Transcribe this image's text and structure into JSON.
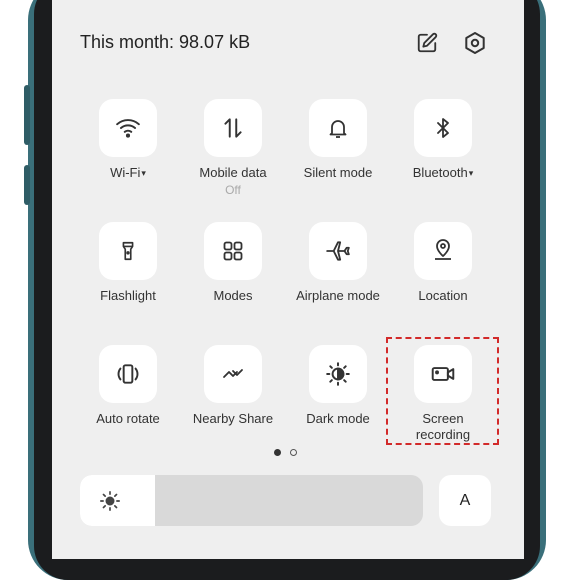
{
  "header": {
    "usage_text": "This month: 98.07 kB",
    "edit_icon": "edit-icon",
    "settings_icon": "settings-icon"
  },
  "tiles": [
    {
      "label": "Wi-Fi",
      "caret": "▾",
      "icon": "wifi-icon"
    },
    {
      "label": "Mobile data",
      "sub": "Off",
      "icon": "mobile-data-icon"
    },
    {
      "label": "Silent mode",
      "icon": "bell-icon"
    },
    {
      "label": "Bluetooth",
      "caret": "▾",
      "icon": "bluetooth-icon"
    },
    {
      "label": "Flashlight",
      "icon": "flashlight-icon"
    },
    {
      "label": "Modes",
      "icon": "modes-icon"
    },
    {
      "label": "Airplane mode",
      "icon": "airplane-icon"
    },
    {
      "label": "Location",
      "icon": "location-icon"
    },
    {
      "label": "Auto rotate",
      "icon": "auto-rotate-icon"
    },
    {
      "label": "Nearby Share",
      "icon": "nearby-share-icon"
    },
    {
      "label": "Dark mode",
      "icon": "dark-mode-icon"
    },
    {
      "label": "Screen recording",
      "icon": "screen-recording-icon"
    }
  ],
  "pager": {
    "pages": 2,
    "current": 1
  },
  "brightness": {
    "level": 0.22,
    "icon": "brightness-icon"
  },
  "auto_brightness": {
    "label": "A"
  },
  "colors": {
    "panel": "#efefef",
    "tile": "#ffffff",
    "highlight": "#d22a2a",
    "frame": "#3a6f7a"
  }
}
